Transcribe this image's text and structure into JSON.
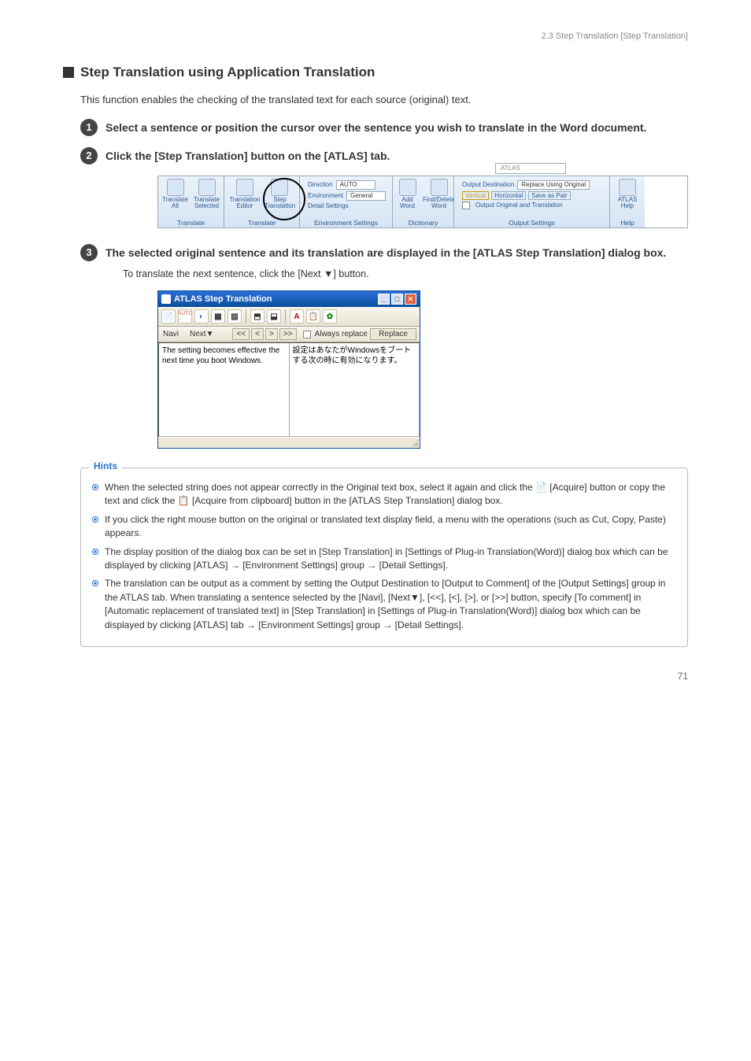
{
  "header_right": "2.3  Step Translation [Step Translation]",
  "heading": "Step Translation using Application Translation",
  "intro": "This function enables the checking of the translated text for each source (original) text.",
  "steps": {
    "s1": {
      "num": "1",
      "text": "Select a sentence or position the cursor over the sentence you wish to translate in the Word document."
    },
    "s2": {
      "num": "2",
      "text": "Click the [Step Translation] button on the [ATLAS] tab."
    },
    "s3": {
      "num": "3",
      "text": "The selected original sentence and its translation are displayed in the [ATLAS Step Translation] dialog box.",
      "sub": "To translate the next sentence, click the [Next ▼] button."
    }
  },
  "toolbar": {
    "search_placeholder": "ATLAS",
    "groups": {
      "translate": {
        "label": "Translate",
        "btn_all": "Translate\nAll",
        "btn_selected": "Translate\nSelected"
      },
      "translate2": {
        "label": "Translate",
        "btn_editor": "Translation\nEditor",
        "btn_step": "Step\nTranslation"
      },
      "env": {
        "label": "Environment Settings",
        "direction": "Direction",
        "direction_val": "AUTO",
        "environment": "Environment",
        "environment_val": "General",
        "detail": "Detail Settings"
      },
      "dict": {
        "label": "Dictionary",
        "btn_add": "Add\nWord",
        "btn_find": "Find/Delete\nWord"
      },
      "output": {
        "label": "Output Settings",
        "dest": "Output Destination",
        "dest_val": "Replace Using Original",
        "vertical": "Vertical",
        "horizontal": "Horizontal",
        "savepair": "Save as Pair",
        "outorig": "Output Original and Translation"
      },
      "help": {
        "label": "Help",
        "btn": "ATLAS\nHelp"
      }
    }
  },
  "dialog": {
    "title": "ATLAS Step Translation",
    "navi": "Navi",
    "next": "Next▼",
    "nav_first": "<<",
    "nav_prev": "<",
    "nav_next": ">",
    "nav_last": ">>",
    "always_replace": "Always replace",
    "replace": "Replace",
    "src": "The setting becomes effective the next time you boot Windows.",
    "tgt": "設定はあなたがWindowsをブートする次の時に有効になります。"
  },
  "hints": {
    "label": "Hints",
    "h1_a": "When the selected string does not appear correctly in the Original text box, select it again and click the ",
    "h1_b": " [Acquire] button or copy the text and click the ",
    "h1_c": " [Acquire from clipboard] button in the [ATLAS Step Translation] dialog box.",
    "h2": "If you click the right mouse button on the original or translated text display field, a menu with the operations (such as Cut, Copy, Paste) appears.",
    "h3_a": "The display position of the dialog box can be set in [Step Translation] in [Settings of Plug-in Translation(Word)] dialog box which can be displayed by clicking [ATLAS] ",
    "h3_b": " [Environment Settings] group ",
    "h3_c": " [Detail Settings].",
    "h4_a": "The translation can be output as a comment by setting the Output Destination to [Output to Comment] of the [Output Settings] group in the ATLAS tab. When translating a sentence selected by the [Navi], [Next▼], [<<], [<], [>], or [>>] button, specify [To comment] in [Automatic replacement of translated text] in [Step Translation] in [Settings of Plug-in Translation(Word)] dialog box which can be displayed by clicking [ATLAS] tab ",
    "h4_b": " [Environment Settings] group ",
    "h4_c": " [Detail Settings]."
  },
  "page_num": "71"
}
